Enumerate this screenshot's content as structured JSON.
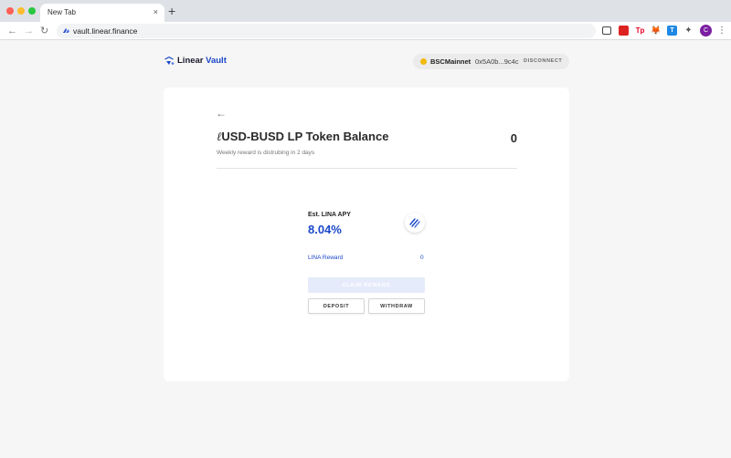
{
  "browser": {
    "tab_title": "New Tab",
    "tab_close": "×",
    "new_tab": "+",
    "url": "vault.linear.finance",
    "nav": {
      "back": "←",
      "forward": "→",
      "reload": "↻"
    },
    "extensions": [
      {
        "name": "screenshot-icon"
      },
      {
        "name": "red-extension-icon",
        "label": ""
      },
      {
        "name": "tp-extension-icon",
        "label": "Tp"
      },
      {
        "name": "metamask-icon",
        "label": "🦊"
      },
      {
        "name": "t-extension-icon",
        "label": "T"
      },
      {
        "name": "puzzle-icon",
        "label": "✦"
      }
    ],
    "avatar_initial": "C",
    "menu": "⋮"
  },
  "header": {
    "brand_part1": "Linear",
    "brand_part2": "Vault",
    "wallet": {
      "network": "BSCMainnet",
      "address": "0x5A0b...9c4c",
      "disconnect": "DISCONNECT"
    }
  },
  "pool": {
    "back": "←",
    "title_prefix": "ℓ",
    "title": "USD-BUSD LP Token Balance",
    "balance": "0",
    "subtitle": "Weekly reward is distrubing in 2 days",
    "apy_label": "Est. LINA APY",
    "apy_value": "8.04%",
    "reward_label": "LINA Reward",
    "reward_value": "0",
    "claim_label": "CLAIM REWARD",
    "deposit_label": "DEPOSIT",
    "withdraw_label": "WITHDRAW"
  },
  "colors": {
    "accent": "#1a47c8",
    "claim_disabled": "#e6ebfb",
    "bnb": "#f0b90b"
  }
}
